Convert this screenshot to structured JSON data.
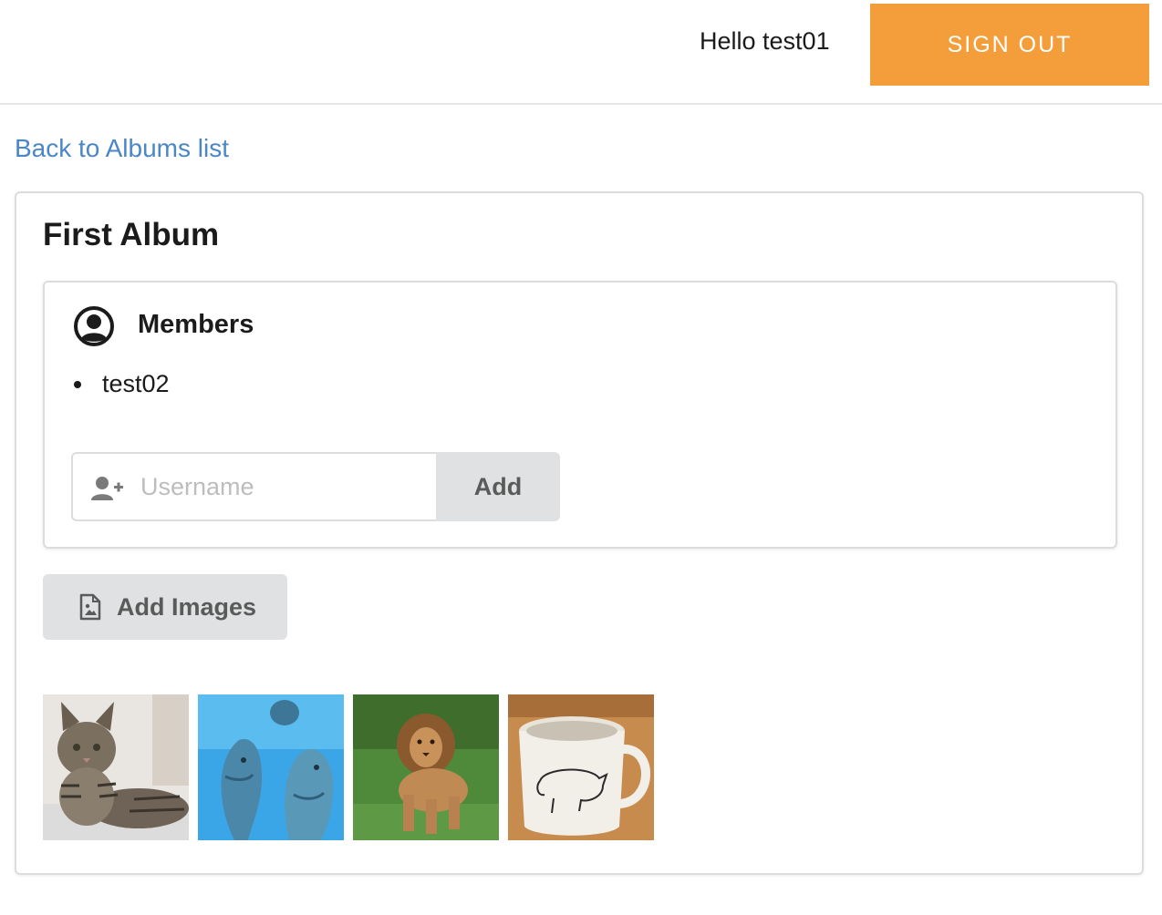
{
  "header": {
    "greeting": "Hello test01",
    "signout_label": "SIGN OUT",
    "signout_color": "#f49e3b"
  },
  "nav": {
    "back_link": "Back to Albums list",
    "link_color": "#4a86c8"
  },
  "album": {
    "title": "First Album",
    "members": {
      "title": "Members",
      "icon": "user-circle-icon",
      "list": [
        "test02"
      ],
      "input_icon": "user-plus-icon",
      "input_placeholder": "Username",
      "input_value": "",
      "add_label": "Add"
    },
    "add_images": {
      "label": "Add Images",
      "icon": "file-image-icon"
    },
    "images": [
      {
        "name": "cat-thumbnail"
      },
      {
        "name": "dolphins-thumbnail"
      },
      {
        "name": "lion-thumbnail"
      },
      {
        "name": "mug-thumbnail"
      }
    ]
  }
}
